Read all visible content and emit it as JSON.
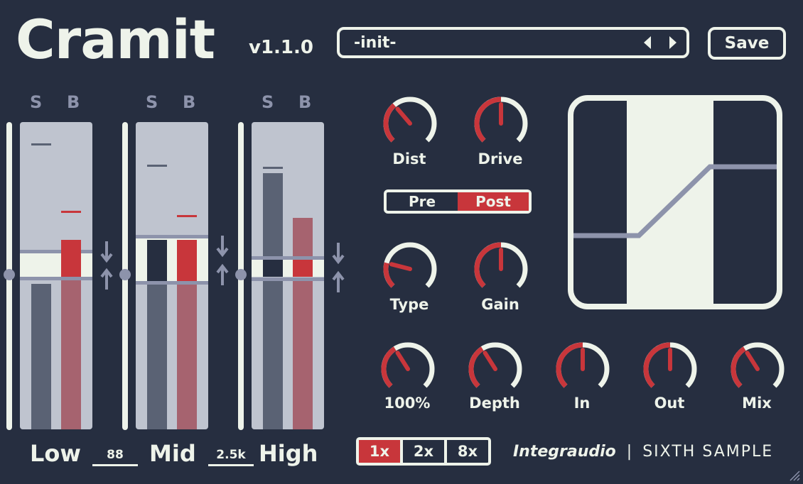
{
  "header": {
    "title": "Cramit",
    "version": "v1.1.0",
    "preset_name": "-init-",
    "save_label": "Save"
  },
  "bands": [
    {
      "solo_label": "S",
      "bypass_label": "B",
      "name": "Low",
      "input_level": 0.47,
      "output_level": 0.62
    },
    {
      "solo_label": "S",
      "bypass_label": "B",
      "name": "Mid",
      "input_level": 0.47,
      "output_level": 0.62
    },
    {
      "solo_label": "S",
      "bypass_label": "B",
      "name": "High",
      "input_level": 0.84,
      "output_level": 0.69
    }
  ],
  "crossovers": [
    "88",
    "2.5k"
  ],
  "knobs": {
    "dist": {
      "label": "Dist",
      "value": 0.35
    },
    "drive": {
      "label": "Drive",
      "value": 0.5
    },
    "type": {
      "label": "Type",
      "value": 0.22
    },
    "gain": {
      "label": "Gain",
      "value": 0.5
    },
    "depth_pct": {
      "label": "100%",
      "value": 0.38
    },
    "depth": {
      "label": "Depth",
      "value": 0.38
    },
    "in": {
      "label": "In",
      "value": 0.5
    },
    "out": {
      "label": "Out",
      "value": 0.5
    },
    "mix": {
      "label": "Mix",
      "value": 0.38
    }
  },
  "prepost": {
    "pre_label": "Pre",
    "post_label": "Post",
    "selected": "Post"
  },
  "oversampling": {
    "options": [
      "1x",
      "2x",
      "8x"
    ],
    "selected": "1x"
  },
  "branding": {
    "brand1": "Integraudio",
    "separator": "|",
    "brand2": "SIXTH SAMPLE"
  },
  "colors": {
    "bg": "#262e40",
    "accent": "#c8363b",
    "light": "#eef3ea",
    "muted": "#8d93ab",
    "panel": "#bfc4cf"
  }
}
